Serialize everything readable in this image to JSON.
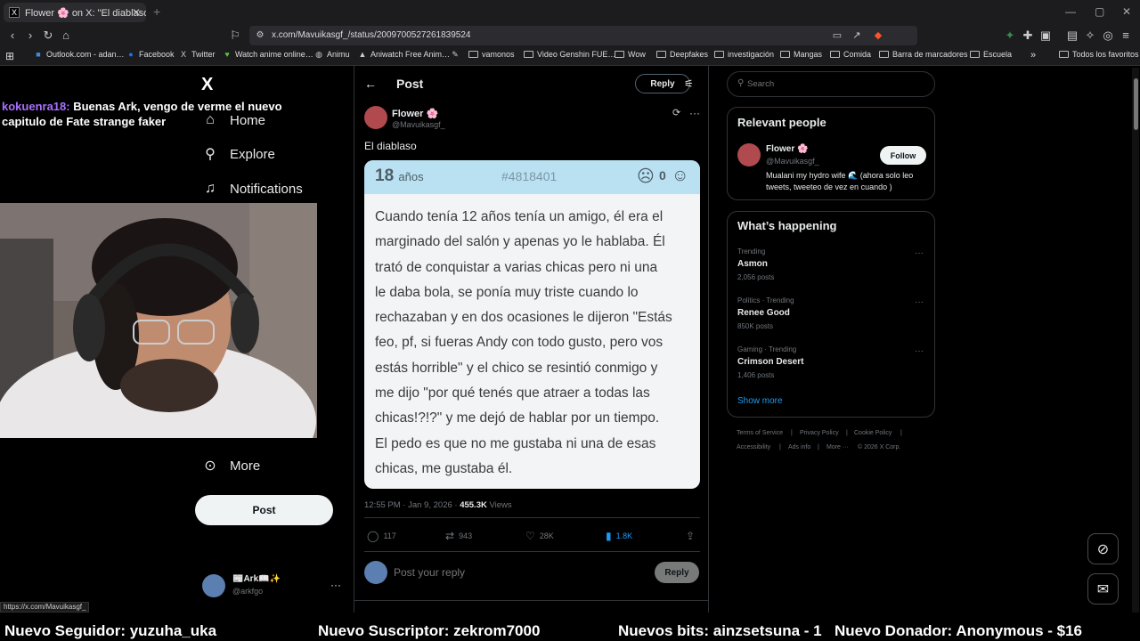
{
  "browser": {
    "tab_title": "Flower 🌸 on X: \"El diablaso htt…",
    "tab_close": "✕",
    "new_tab": "+",
    "url": "x.com/Mavuikasgf_/status/2009700527261839524",
    "bookmarks": [
      "Outlook.com - adan…",
      "Facebook",
      "Twitter",
      "Watch anime online…",
      "Animu",
      "Aniwatch Free Anim…",
      "vamonos",
      "Video Genshin FUE…",
      "Wow",
      "Deepfakes",
      "investigación",
      "Mangas",
      "Comida",
      "Barra de marcadores",
      "Escuela",
      "Todos los favoritos"
    ],
    "status_url": "https://x.com/Mavuikasgf_"
  },
  "left_nav": {
    "logo": "X",
    "items": [
      {
        "label": "Home",
        "icon": "home-icon"
      },
      {
        "label": "Explore",
        "icon": "search-icon"
      },
      {
        "label": "Notifications",
        "icon": "bell-icon"
      },
      {
        "label": "More",
        "icon": "more-circle-icon"
      }
    ],
    "post_button": "Post",
    "account_name": "📰Ark📖✨",
    "account_handle": "@arkfgo"
  },
  "chat": {
    "user": "kokuenra18:",
    "message": "Buenas Ark, vengo de verme el nuevo capitulo de Fate strange faker"
  },
  "post": {
    "header_title": "Post",
    "reply_label": "Reply",
    "author_name": "Flower 🌸",
    "author_handle": "@Mavuikasgf_",
    "text": "El diablaso",
    "card": {
      "age": "18",
      "age_unit": "años",
      "id": "#4818401",
      "vote_count": "0",
      "body": "Cuando tenía 12 años tenía un amigo, él era el\nmarginado del salón y apenas yo le hablaba. Él\ntrató de conquistar a varias chicas pero ni una\nle daba bola, se ponía muy triste cuando lo\nrechazaban y en dos ocasiones le dijeron \"Estás\nfeo, pf, si fueras Andy con todo gusto, pero vos\nestás horrible\" y el chico se resintió conmigo y\nme dijo \"por qué tenés que atraer a todas las\nchicas!?!?\" y me dejó de hablar por un tiempo.\nEl pedo es que no me gustaba ni una de esas\nchicas, me gustaba él."
    },
    "timestamp": "12:55 PM · Jan 9, 2026 · ",
    "views_count": "455.3K",
    "views_label": "Views",
    "stats": {
      "replies": "117",
      "reposts": "943",
      "likes": "28K",
      "bookmarks": "1.8K"
    },
    "reply_placeholder": "Post your reply",
    "reply_button": "Reply"
  },
  "right": {
    "search_placeholder": "Search",
    "relevant_title": "Relevant people",
    "relevant_name": "Flower 🌸",
    "relevant_handle": "@Mavuikasgf_",
    "follow_label": "Follow",
    "relevant_bio": "Mualani my hydro wife 🌊 (ahora solo leo tweets, tweeteo de vez en cuando )",
    "happening_title": "What’s happening",
    "trends": [
      {
        "meta": "Trending",
        "name": "Asmon",
        "posts": "2,056 posts"
      },
      {
        "meta": "Politics · Trending",
        "name": "Renee Good",
        "posts": "850K posts"
      },
      {
        "meta": "Gaming · Trending",
        "name": "Crimson Desert",
        "posts": "1,406 posts"
      }
    ],
    "show_more": "Show more",
    "footer": [
      "Terms of Service",
      "Privacy Policy",
      "Cookie Policy",
      "Accessibility",
      "Ads info",
      "More ···",
      "© 2026 X Corp."
    ]
  },
  "alerts": {
    "follower": "Nuevo Seguidor: yuzuha_uka",
    "subscriber": "Nuevo Suscriptor: zekrom7000",
    "bits": "Nuevos bits: ainzsetsuna - 1",
    "donor": "Nuevo Donador: Anonymous - $16"
  },
  "colors": {
    "accent_blue": "#1d9bf0",
    "chat_user": "#a970ff",
    "card_header": "#b9e1f2"
  }
}
